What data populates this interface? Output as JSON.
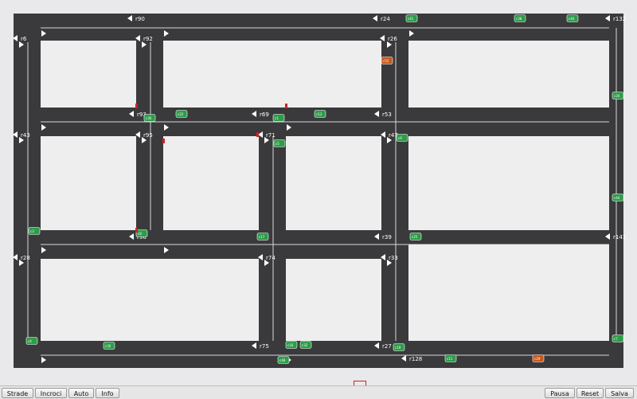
{
  "road_labels": [
    "r90",
    "r24",
    "r132",
    "r6",
    "r92",
    "r26",
    "r93",
    "r69",
    "r53",
    "r43",
    "r95",
    "r71",
    "r47",
    "r96",
    "r39",
    "r141",
    "r28",
    "r74",
    "r33",
    "r75",
    "r27",
    "r128"
  ],
  "car_labels": [
    "c41",
    "c38",
    "c40",
    "c52",
    "c20",
    "c22",
    "c13",
    "c1",
    "c5",
    "c9",
    "c44",
    "c3",
    "c25",
    "c30",
    "c16",
    "c32",
    "c48",
    "c11",
    "c29",
    "c7",
    "c17",
    "c8",
    "c4",
    "c19",
    "c36"
  ],
  "colors": {
    "road": "#3a393b",
    "block": "#efeeef",
    "car_green": "#2e9c4a",
    "car_orange": "#c8591c",
    "signal_red": "#cc2222"
  },
  "buttons": {
    "left": [
      "Strade",
      "Incroci",
      "Auto",
      "Info"
    ],
    "right": [
      "Pausa",
      "Reset",
      "Salva"
    ]
  }
}
